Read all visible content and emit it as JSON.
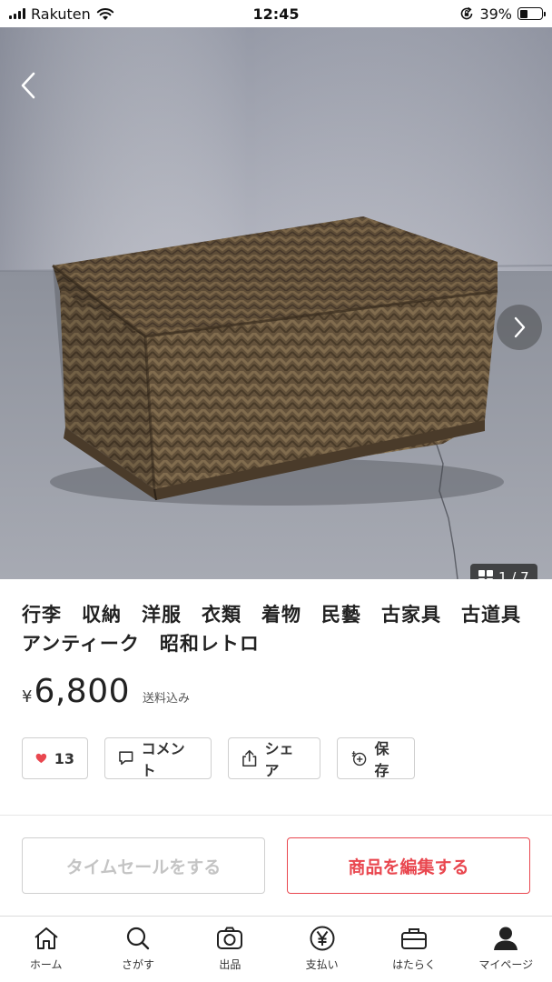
{
  "status_bar": {
    "carrier": "Rakuten",
    "time": "12:45",
    "battery_text": "39%",
    "battery_level": 0.39
  },
  "gallery": {
    "counter": "1 / 7",
    "icons": {
      "back": "chevron-left-icon",
      "next": "chevron-right-icon",
      "grid": "grid-icon"
    }
  },
  "product": {
    "title": "行李　収納　洋服　衣類　着物　民藝　古家具　古道具　アンティーク　昭和レトロ",
    "currency": "¥",
    "price": "6,800",
    "shipping": "送料込み"
  },
  "actions": {
    "like_count": "13",
    "comment_label": "コメント",
    "share_label": "シェア",
    "save_label": "保存"
  },
  "buttons": {
    "timesale_label": "タイムセールをする",
    "edit_label": "商品を編集する"
  },
  "colors": {
    "accent": "#e9474f",
    "disabled_text": "#c4c4c4"
  },
  "tabbar": {
    "items": [
      {
        "label": "ホーム",
        "icon": "home-icon"
      },
      {
        "label": "さがす",
        "icon": "search-icon"
      },
      {
        "label": "出品",
        "icon": "camera-icon"
      },
      {
        "label": "支払い",
        "icon": "yen-icon"
      },
      {
        "label": "はたらく",
        "icon": "briefcase-icon"
      },
      {
        "label": "マイページ",
        "icon": "person-icon"
      }
    ]
  }
}
